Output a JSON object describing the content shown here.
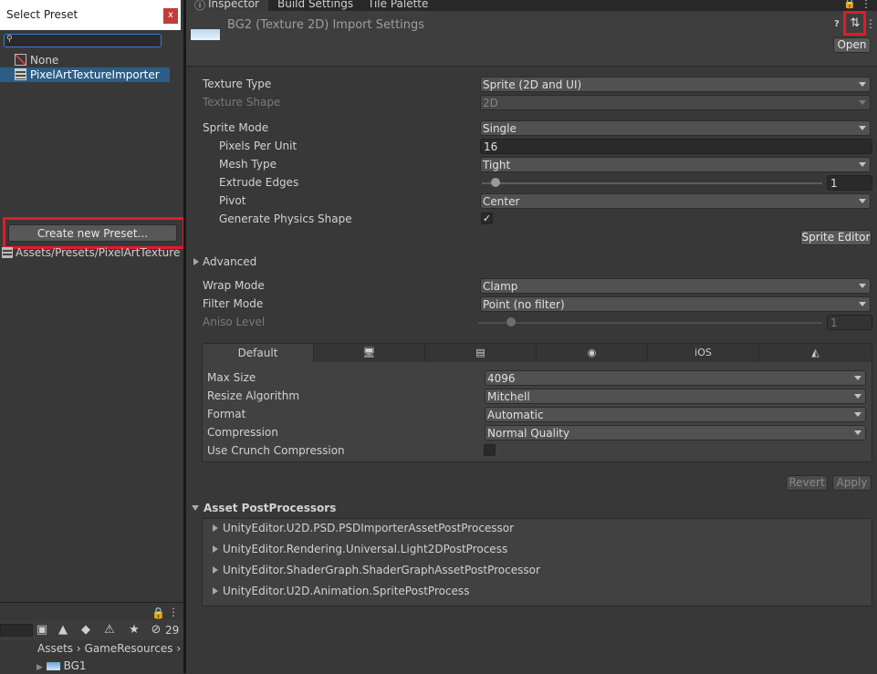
{
  "preset_window": {
    "title": "Select Preset",
    "close": "x",
    "search_value": "",
    "items": [
      {
        "label": "None"
      },
      {
        "label": "PixelArtTextureImporter"
      }
    ],
    "create_button": "Create new Preset...",
    "path": "Assets/Presets/PixelArtTextureImporter.preset"
  },
  "tabs": [
    "Inspector",
    "Build Settings",
    "Tile Palette"
  ],
  "header": {
    "title": "BG2 (Texture 2D) Import Settings",
    "help": "?",
    "open_button": "Open"
  },
  "fields": {
    "texture_type": {
      "label": "Texture Type",
      "value": "Sprite (2D and UI)"
    },
    "texture_shape": {
      "label": "Texture Shape",
      "value": "2D"
    },
    "sprite_mode": {
      "label": "Sprite Mode",
      "value": "Single"
    },
    "pixels_per_unit": {
      "label": "Pixels Per Unit",
      "value": "16"
    },
    "mesh_type": {
      "label": "Mesh Type",
      "value": "Tight"
    },
    "extrude_edges": {
      "label": "Extrude Edges",
      "value": "1",
      "fraction": 0.0
    },
    "pivot": {
      "label": "Pivot",
      "value": "Center"
    },
    "generate_physics": {
      "label": "Generate Physics Shape",
      "checked": true
    },
    "sprite_editor_button": "Sprite Editor",
    "advanced": "Advanced",
    "wrap_mode": {
      "label": "Wrap Mode",
      "value": "Clamp"
    },
    "filter_mode": {
      "label": "Filter Mode",
      "value": "Point (no filter)"
    },
    "aniso_level": {
      "label": "Aniso Level",
      "value": "1",
      "fraction": 0.06
    }
  },
  "platform": {
    "tabs": [
      {
        "label": "Default",
        "icon": null
      },
      {
        "label": "",
        "icon": "monitor-icon"
      },
      {
        "label": "",
        "icon": "server-icon"
      },
      {
        "label": "",
        "icon": "android-icon"
      },
      {
        "label": "iOS",
        "icon": null
      },
      {
        "label": "",
        "icon": "html5-icon"
      }
    ],
    "max_size": {
      "label": "Max Size",
      "value": "4096"
    },
    "resize_algorithm": {
      "label": "Resize Algorithm",
      "value": "Mitchell"
    },
    "format": {
      "label": "Format",
      "value": "Automatic"
    },
    "compression": {
      "label": "Compression",
      "value": "Normal Quality"
    },
    "crunch": {
      "label": "Use Crunch Compression",
      "checked": false
    }
  },
  "actions": {
    "revert": "Revert",
    "apply": "Apply"
  },
  "postprocessors": {
    "title": "Asset PostProcessors",
    "items": [
      "UnityEditor.U2D.PSD.PSDImporterAssetPostProcessor",
      "UnityEditor.Rendering.Universal.Light2DPostProcess",
      "UnityEditor.ShaderGraph.ShaderGraphAssetPostProcessor",
      "UnityEditor.U2D.Animation.SpritePostProcess"
    ]
  },
  "project": {
    "hidden_count": "29",
    "breadcrumb": [
      "Assets",
      "GameResources"
    ],
    "item": "BG1"
  },
  "colors": {
    "highlight": "#e5192b",
    "selection": "#2c5d87",
    "background": "#383838"
  }
}
